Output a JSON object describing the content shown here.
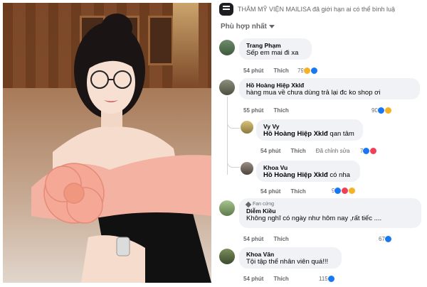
{
  "banner": {
    "text": "THẨM MỸ VIỆN MAILISA đã giới hạn ai có thể bình luậ"
  },
  "sort": {
    "label": "Phù hợp nhất"
  },
  "comments": [
    {
      "name": "Trang Phạm",
      "text": "Sếp em mai đi xa",
      "time": "54 phút",
      "like_label": "Thích",
      "reactions": "79"
    },
    {
      "name": "Hồ Hoàng Hiệp Xklđ",
      "text": "hàng mua về chưa dùng trả lại đc ko shop ơi",
      "time": "55 phút",
      "like_label": "Thích",
      "reactions": "90"
    },
    {
      "name": "Vy Vy",
      "mention": "Hồ Hoàng Hiệp Xklđ",
      "text": " qan tâm",
      "time": "54 phút",
      "like_label": "Thích",
      "edit_label": "Đã chỉnh sửa",
      "reactions": "7"
    },
    {
      "name": "Khoa Vu",
      "mention": "Hồ Hoàng Hiệp Xklđ",
      "text": " có nha",
      "time": "54 phút",
      "like_label": "Thích",
      "reactions": "9"
    },
    {
      "fan_badge": "Fan cứng",
      "name": "Diễm Kiều",
      "text": "Không nghĩ có ngày như hôm nay ,rất tiếc ....",
      "time": "54 phút",
      "like_label": "Thích",
      "reactions": "67"
    },
    {
      "name": "Khoa Văn",
      "text": "Tội tập thể nhân viên quá!!!",
      "time": "54 phút",
      "like_label": "Thích",
      "reactions": "115"
    }
  ],
  "icons": [
    "comment-bubble-icon",
    "caret-down-icon",
    "like-reaction-icon",
    "haha-reaction-icon",
    "love-reaction-icon",
    "fan-badge-icon"
  ],
  "colors": {
    "bubble_bg": "#f0f2f5",
    "meta_text": "#65676b",
    "like_blue": "#1877f2",
    "haha_yellow": "#f7b125",
    "love_red": "#f33e58"
  }
}
